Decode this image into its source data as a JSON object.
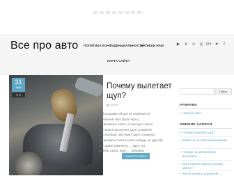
{
  "header": {
    "site_title": "Все про авто",
    "nav": [
      {
        "label": "ПОЛИТИКА КОНФИДЕНЦИАЛЬНОСТИ"
      },
      {
        "label": "НАПИШИ НАМ"
      },
      {
        "label": "КАРТА САЙТА"
      }
    ],
    "social": [
      {
        "icon": "youtube-icon",
        "glyph": "▶"
      },
      {
        "icon": "vk-icon",
        "glyph": "в"
      },
      {
        "icon": "odnoklassniki-icon",
        "glyph": "о"
      },
      {
        "icon": "instagram-icon",
        "glyph": "◎"
      },
      {
        "icon": "google-plus-icon",
        "glyph": "G+"
      },
      {
        "icon": "twitter-icon",
        "glyph": "♥"
      },
      {
        "icon": "facebook-icon",
        "glyph": "f"
      }
    ]
  },
  "post": {
    "date_day": "31",
    "date_month": "Май",
    "comments": "0",
    "title": "Почему вылетает щуп?",
    "author": "admin",
    "excerpt": [
      "С большими оборотах начинается",
      "страшный звук (буль-буль),",
      "открываешь капот, а там щуп торчит",
      "или вовсе выскочил. Щуп сломался",
      "или вообще там брак? Щуп сломался",
      "(перезакрыл меня какое-нибудь не другой)",
      "или даже заменить. ... Щуп это",
      "разбор щупа, еще … трещины"
    ],
    "category_button": "НОВОСТИ АВТО"
  },
  "sidebar": {
    "search_placeholder": "",
    "search_button": "Поиск",
    "rubrics_title": "РУБРИКИ",
    "rubrics": [
      "Новости авто"
    ],
    "recent_title": "СВЕЖИЕ ЗАПИСИ",
    "recent": [
      "Почему вылетает щуп?",
      "Хамбы по интересным заменам",
      "Почему на автомобилях выступает...",
      "Как отличить дорогостоящий масло?",
      "Как не уезжать дорожный..."
    ]
  },
  "colors": {
    "accent": "#5fa8c6",
    "header_bg": "#f5f5f5"
  }
}
